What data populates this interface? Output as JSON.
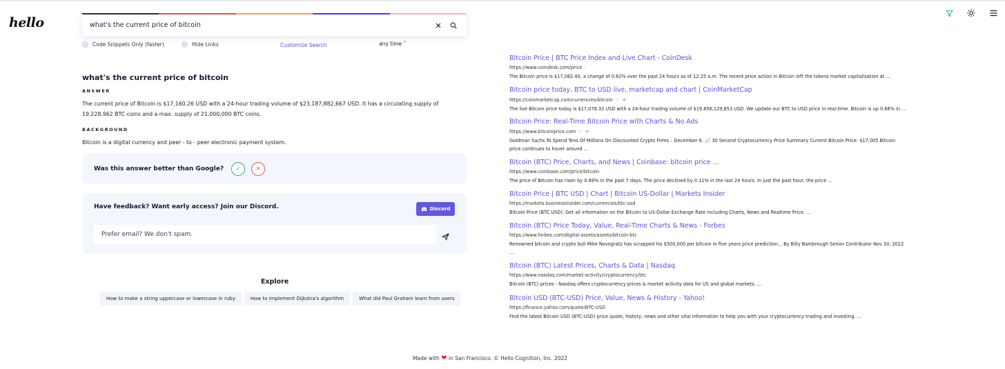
{
  "app": {
    "logo": "hello"
  },
  "colors": {
    "accent": "#5c4fe0",
    "rainbow": [
      "#2a2a4a",
      "#e0504f",
      "#f3a35d",
      "#4f3ad6",
      "#f5b1bf"
    ]
  },
  "top_icons": [
    "filter-icon",
    "sun-icon",
    "menu-icon"
  ],
  "search": {
    "query": "what's the current price of bitcoin"
  },
  "options": {
    "code_snippets": "Code Snippets Only (faster)",
    "hide_links": "Hide Links",
    "customize": "Customize Search",
    "time_filter": "any time"
  },
  "answer": {
    "question": "what's the current price of bitcoin",
    "answer_label": "ANSWER",
    "answer_text": "The current price of Bitcoin is $17,160.26 USD with a 24-hour trading volume of $23,187,882,667 USD. It has a circulating supply of 19,228,962 BTC coins and a max. supply of 21,000,000 BTC coins.",
    "background_label": "BACKGROUND",
    "background_text": "Bitcoin is a digital currency and peer - to - peer electronic payment system."
  },
  "rating": {
    "question": "Was this answer better than Google?"
  },
  "feedback": {
    "prompt": "Have feedback? Want early access? Join our Discord.",
    "discord_label": "Discord",
    "email_placeholder": "Prefer email? We don't spam."
  },
  "explore": {
    "title": "Explore",
    "chips": [
      "How to make a string uppercase or lowercase in ruby",
      "How to implement Dijkstra's algorithm",
      "What did Paul Graham learn from users"
    ]
  },
  "results": [
    {
      "title": "Bitcoin Price | BTC Price Index and Live Chart - CoinDesk",
      "url": "https://www.coindesk.com/price",
      "desc": "The Bitcoin price is $17,082.40, a change of 0.62% over the past 24 hours as of 12:25 a.m. The recent price action in Bitcoin left the tokens market capitalization at ..."
    },
    {
      "title": "Bitcoin price today, BTC to USD live, marketcap and chart | CoinMarketCap",
      "url": "https://coinmarketcap.com/currencies/bitcoin",
      "desc": "The live Bitcoin price today is $17,076.33 USD with a 24-hour trading volume of $19,656,129,853 USD. We update our BTC to USD price in real-time. Bitcoin is up 0.66% in ..."
    },
    {
      "title": "Bitcoin Price: Real-Time Bitcoin Price with Charts & No Ads",
      "url": "https://www.bitcoinprice.com",
      "desc": "Goldman Sachs To Spend Tens Of Millions On Discounted Crypto Firms – December 6. 📈 30 Second Cryptocurrency Price Summary Current Bitcoin Price: $17,005 Bitcoin price continues to hover around ..."
    },
    {
      "title": "Bitcoin (BTC) Price, Charts, and News | Coinbase: bitcoin price ...",
      "url": "https://www.coinbase.com/price/bitcoin",
      "desc": "The price of Bitcoin has risen by 0.89% in the past 7 days. The price declined by 0.11% in the last 24 hours. In just the past hour, the price ..."
    },
    {
      "title": "Bitcoin Price | BTC USD | Chart | Bitcoin US-Dollar | Markets Insider",
      "url": "https://markets.businessinsider.com/currencies/btc-usd",
      "desc": "Bitcoin Price (BTC USD): Get all information on the Bitcoin to US-Dollar Exchange Rate including Charts, News and Realtime Price. ..."
    },
    {
      "title": "Bitcoin (BTC) Price Today, Value, Real-Time Charts & News - Forbes",
      "url": "https://www.forbes.com/digital-assets/assets/bitcoin-btc",
      "desc": "Renowned bitcoin and crypto bull Mike Novogratz has scrapped his $500,000 per bitcoin in five years price prediction... By Billy Bambrough Senior Contributor Nov 30, 2022 ..."
    },
    {
      "title": "Bitcoin (BTC) Latest Prices, Charts & Data | Nasdaq",
      "url": "https://www.nasdaq.com/market-activity/cryptocurrency/btc",
      "desc": "Bitcoin (BTC) prices - Nasdaq offers cryptocurrency prices & market activity data for US and global markets. ..."
    },
    {
      "title": "Bitcoin USD (BTC-USD) Price, Value, News & History - Yahoo!",
      "url": "https://finance.yahoo.com/quote/BTC-USD",
      "desc": "Find the latest Bitcoin USD (BTC-USD) price quote, history, news and other vital information to help you with your cryptocurrency trading and investing. ..."
    }
  ],
  "footer": {
    "before": "Made with",
    "after": "in San Francisco. © Hello Cognition, Inc. 2022"
  }
}
